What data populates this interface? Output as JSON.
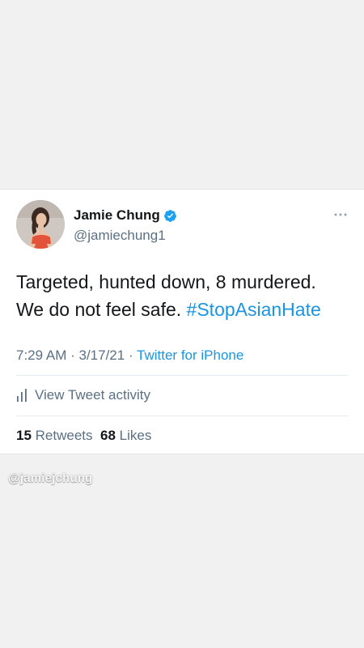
{
  "tweet": {
    "author": {
      "display_name": "Jamie Chung",
      "handle": "@jamiechung1",
      "verified": true
    },
    "text_line1": "Targeted, hunted down, 8 murdered.",
    "text_line2_prefix": "We do not feel safe. ",
    "hashtag": "#StopAsianHate",
    "time": "7:29 AM",
    "separator": " · ",
    "date": "3/17/21",
    "source": "Twitter for iPhone",
    "activity_label": "View Tweet activity",
    "retweet_count": "15",
    "retweet_label": "Retweets",
    "like_count": "68",
    "like_label": "Likes"
  },
  "watermark": "@jamiejchung",
  "colors": {
    "background": "#f1f1f1",
    "link": "#1b95e0",
    "verified": "#1da1f2",
    "secondary_text": "#5b7083",
    "primary_text": "#14171a"
  },
  "icons": [
    "verified-badge-icon",
    "more-options-icon",
    "activity-chart-icon"
  ]
}
